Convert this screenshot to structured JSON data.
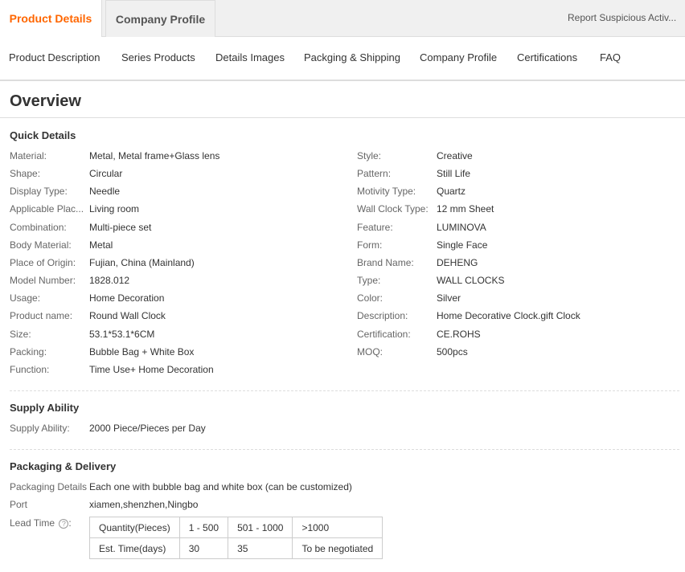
{
  "tabs": {
    "product_details": "Product Details",
    "company_profile": "Company Profile",
    "report": "Report Suspicious Activ..."
  },
  "subnav": [
    "Product Description",
    "Series Products",
    "Details Images",
    "Packging & Shipping",
    "Company Profile",
    "Certifications",
    "FAQ"
  ],
  "overview_title": "Overview",
  "quick_details": {
    "title": "Quick Details",
    "left": [
      {
        "label": "Material:",
        "value": "Metal, Metal frame+Glass lens"
      },
      {
        "label": "Shape:",
        "value": "Circular"
      },
      {
        "label": "Display Type:",
        "value": "Needle"
      },
      {
        "label": "Applicable Plac...",
        "value": "Living room"
      },
      {
        "label": "Combination:",
        "value": "Multi-piece set"
      },
      {
        "label": "Body Material:",
        "value": "Metal"
      },
      {
        "label": "Place of Origin:",
        "value": "Fujian, China (Mainland)"
      },
      {
        "label": "Model Number:",
        "value": "1828.012"
      },
      {
        "label": "Usage:",
        "value": "Home Decoration"
      },
      {
        "label": "Product name:",
        "value": "Round Wall Clock"
      },
      {
        "label": "Size:",
        "value": "53.1*53.1*6CM"
      },
      {
        "label": "Packing:",
        "value": "Bubble Bag + White Box"
      },
      {
        "label": "Function:",
        "value": "Time Use+ Home Decoration"
      }
    ],
    "right": [
      {
        "label": "Style:",
        "value": "Creative"
      },
      {
        "label": "Pattern:",
        "value": "Still Life"
      },
      {
        "label": "Motivity Type:",
        "value": "Quartz"
      },
      {
        "label": "Wall Clock Type:",
        "value": "12 mm Sheet"
      },
      {
        "label": "Feature:",
        "value": "LUMINOVA"
      },
      {
        "label": "Form:",
        "value": "Single Face"
      },
      {
        "label": "Brand Name:",
        "value": "DEHENG"
      },
      {
        "label": "Type:",
        "value": "WALL CLOCKS"
      },
      {
        "label": "Color:",
        "value": "Silver"
      },
      {
        "label": "Description:",
        "value": "Home Decorative Clock.gift Clock"
      },
      {
        "label": "Certification:",
        "value": "CE.ROHS"
      },
      {
        "label": "MOQ:",
        "value": "500pcs"
      }
    ]
  },
  "supply": {
    "title": "Supply Ability",
    "label": "Supply Ability:",
    "value": "2000 Piece/Pieces per Day"
  },
  "packaging": {
    "title": "Packaging & Delivery",
    "details_label": "Packaging Details",
    "details_value": "Each one with bubble bag and white box (can be customized)",
    "port_label": "Port",
    "port_value": "xiamen,shenzhen,Ningbo",
    "lead_label": "Lead Time",
    "lead_icon": "?",
    "lead_table": {
      "row1": [
        "Quantity(Pieces)",
        "1 - 500",
        "501 - 1000",
        ">1000"
      ],
      "row2": [
        "Est. Time(days)",
        "30",
        "35",
        "To be negotiated"
      ]
    }
  },
  "colors": {
    "accent": "#ff6600",
    "border": "#dddddd",
    "label": "#666666",
    "text": "#333333"
  }
}
